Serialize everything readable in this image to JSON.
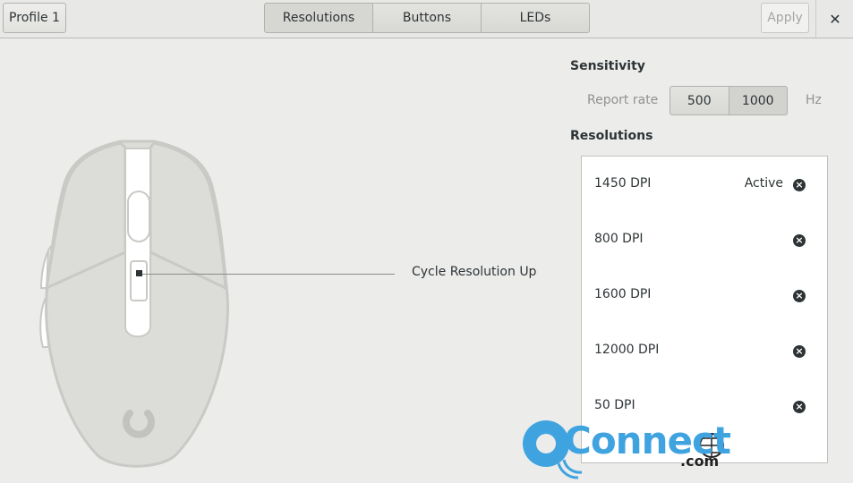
{
  "header": {
    "profile_label": "Profile 1",
    "tabs": [
      {
        "label": "Resolutions",
        "selected": true
      },
      {
        "label": "Buttons",
        "selected": false
      },
      {
        "label": "LEDs",
        "selected": false
      }
    ],
    "apply_label": "Apply",
    "apply_enabled": false,
    "close_glyph": "✕"
  },
  "mouse_view": {
    "callout_label": "Cycle Resolution Up"
  },
  "sensitivity": {
    "title": "Sensitivity",
    "report_rate_label": "Report rate",
    "report_rate_options": [
      "500",
      "1000"
    ],
    "report_rate_selected": "1000",
    "unit": "Hz"
  },
  "resolutions": {
    "title": "Resolutions",
    "items": [
      {
        "dpi": "1450 DPI",
        "status": "Active"
      },
      {
        "dpi": "800 DPI",
        "status": ""
      },
      {
        "dpi": "1600 DPI",
        "status": ""
      },
      {
        "dpi": "12000 DPI",
        "status": ""
      },
      {
        "dpi": "50 DPI",
        "status": ""
      }
    ],
    "remove_glyph": "×"
  },
  "watermark": {
    "main": "Connect",
    "suffix": ".com"
  }
}
